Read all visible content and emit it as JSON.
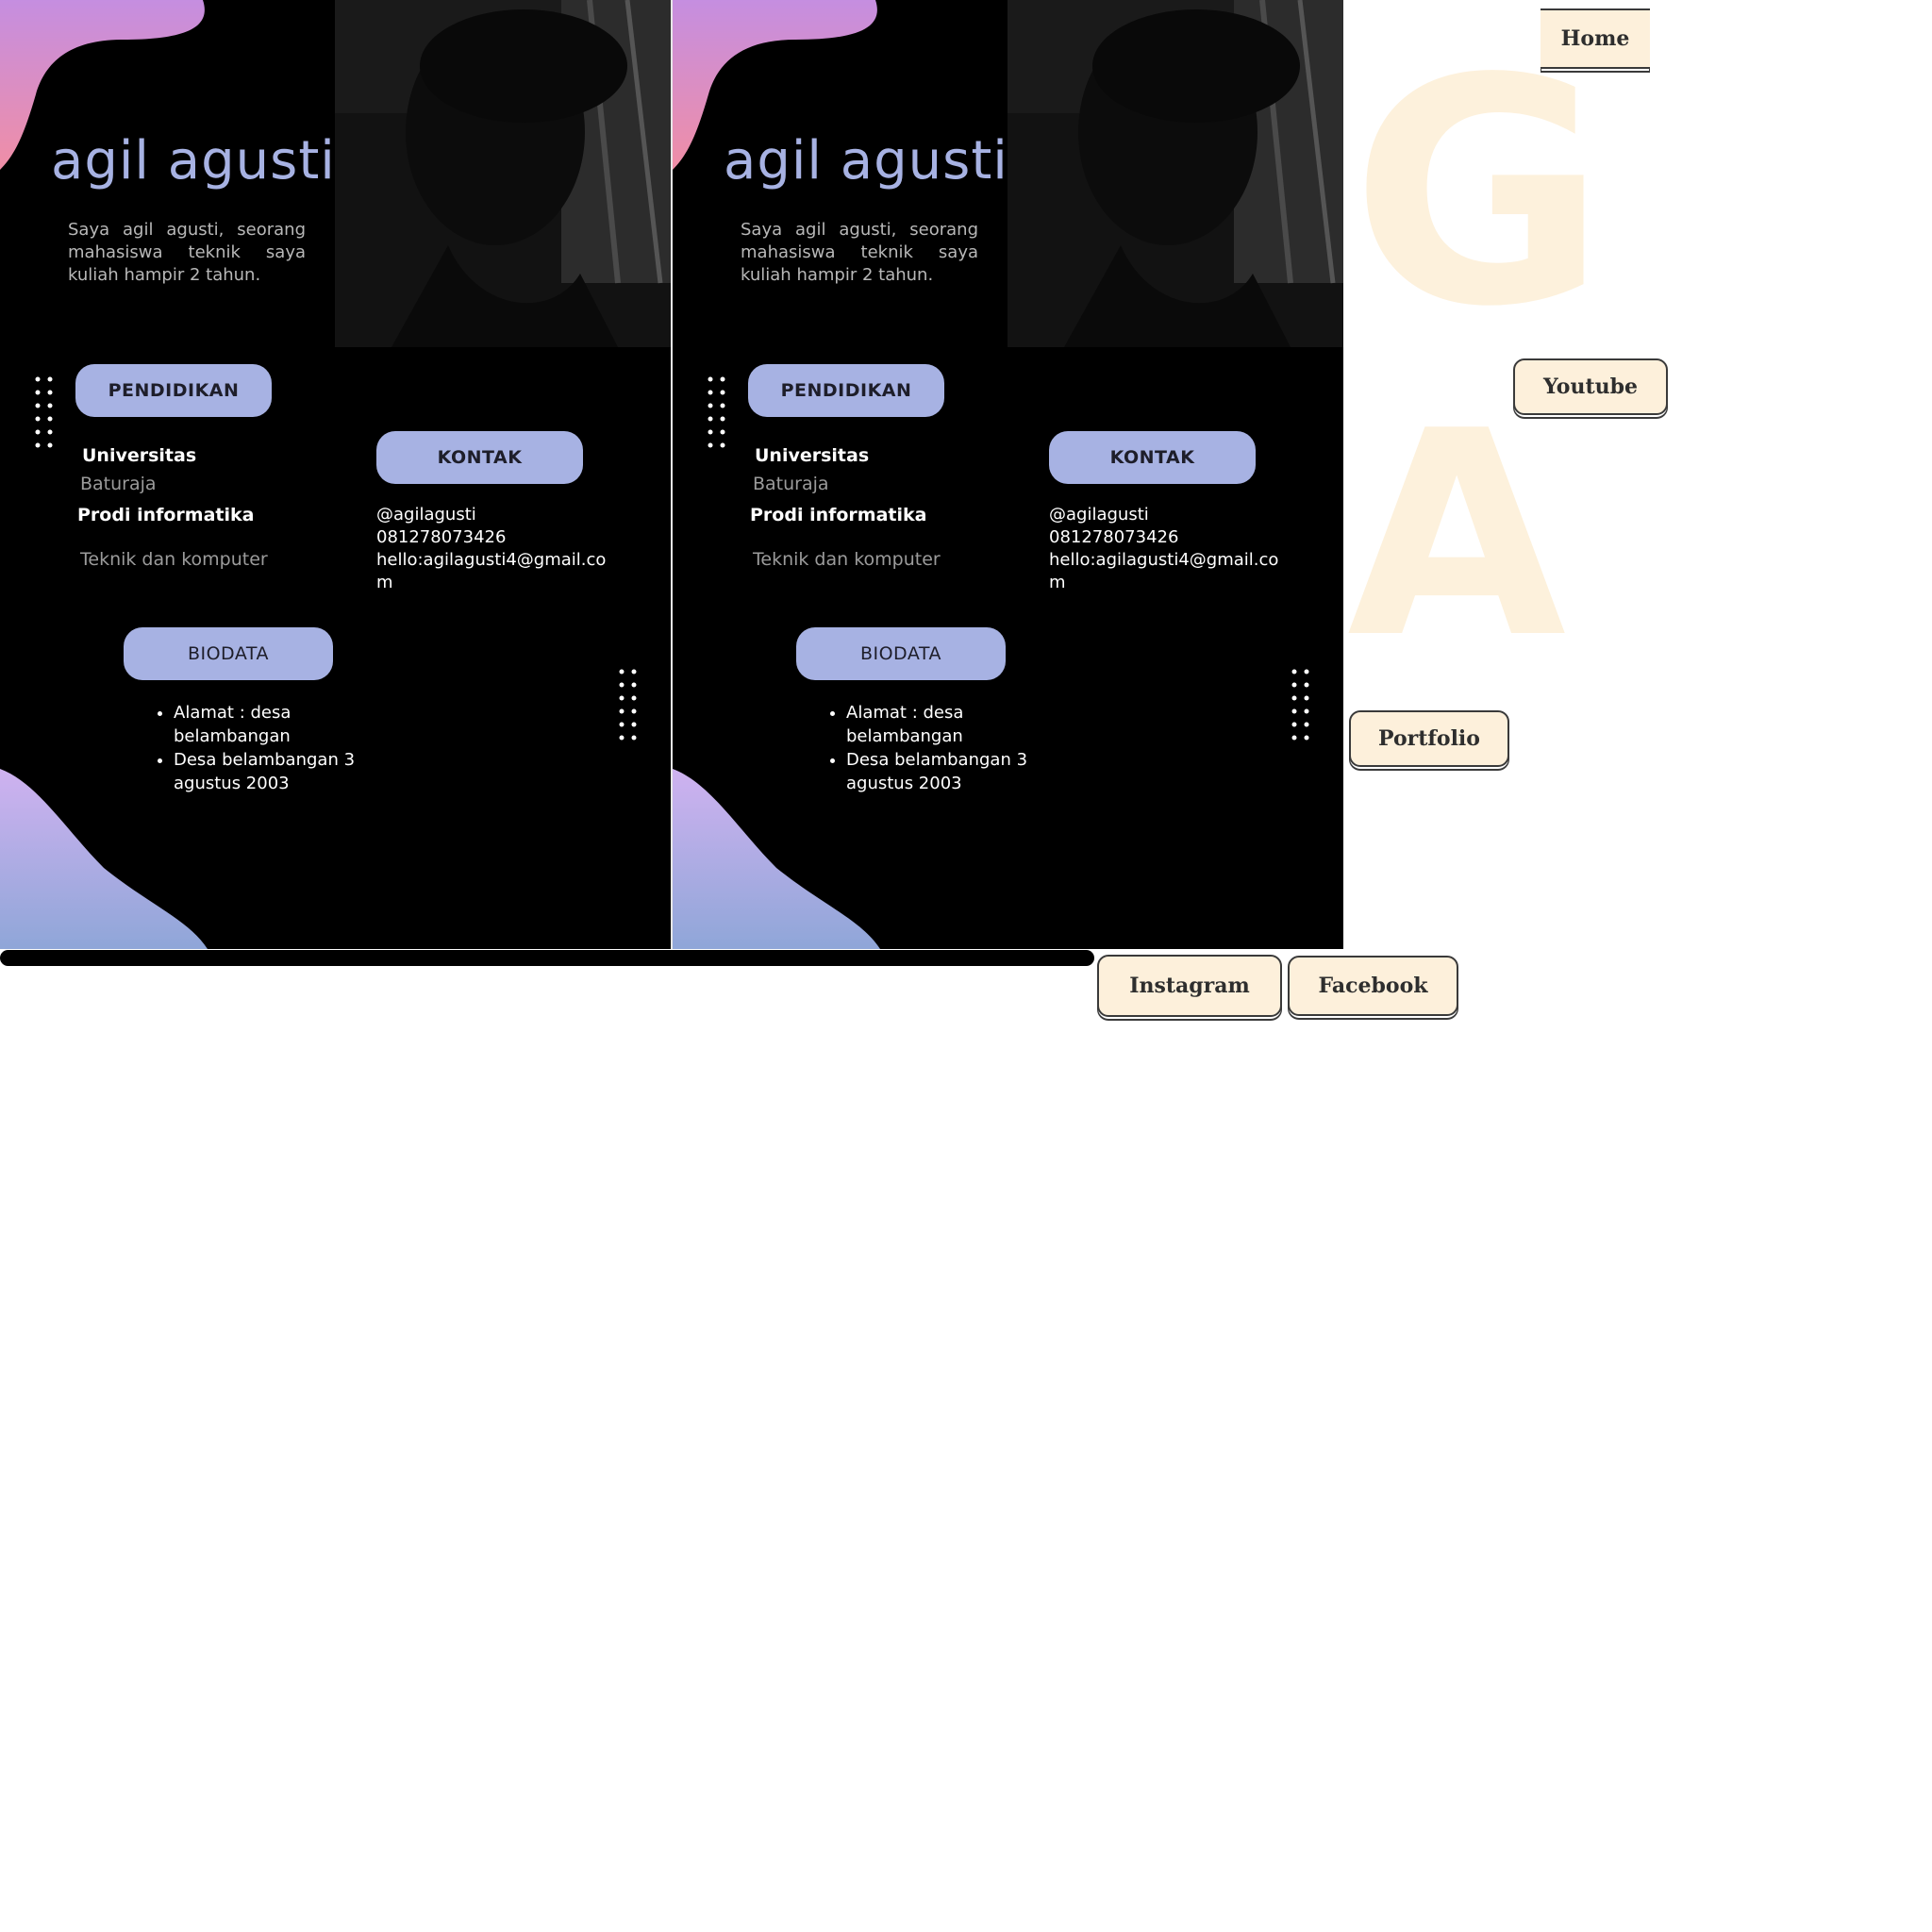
{
  "profile": {
    "name": "agil agusti",
    "intro": "Saya agil agusti, seorang mahasiswa teknik saya kuliah hampir 2 tahun."
  },
  "sections": {
    "pendidikan_label": "PENDIDIKAN",
    "kontak_label": "KONTAK",
    "biodata_label": "BIODATA"
  },
  "education": {
    "university": "Universitas",
    "university_city": "Baturaja",
    "program": "Prodi informatika",
    "faculty": "Teknik dan komputer"
  },
  "contact": {
    "handle": "@agilagusti",
    "phone": "081278073426",
    "email": "hello:agilagusti4@gmail.com"
  },
  "biodata": {
    "items": [
      "Alamat : desa belambangan",
      "Desa belambangan 3 agustus 2003"
    ]
  },
  "decor": {
    "letter_top": "G",
    "letter_bottom": "A"
  },
  "nav": {
    "home": "Home",
    "youtube": "Youtube",
    "portfolio": "Portfolio",
    "instagram": "Instagram",
    "facebook": "Facebook"
  },
  "colors": {
    "accent": "#a7b2e3",
    "card_bg": "#000000",
    "button_bg": "#fdf0db",
    "decor_letters": "#fdf1dc"
  }
}
